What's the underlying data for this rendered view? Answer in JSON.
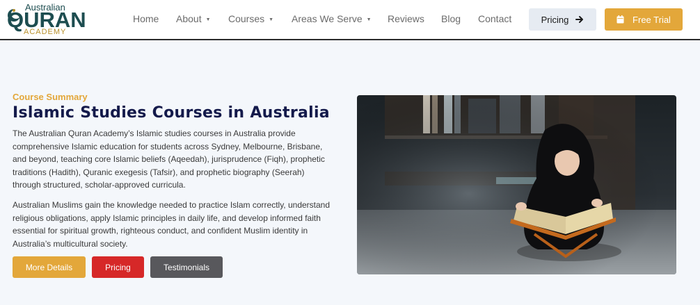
{
  "header": {
    "logo": {
      "top": "Australian",
      "main": "QURAN",
      "bottom": "ACADEMY"
    },
    "nav": [
      {
        "label": "Home",
        "dropdown": false
      },
      {
        "label": "About",
        "dropdown": true
      },
      {
        "label": "Courses",
        "dropdown": true
      },
      {
        "label": "Areas We Serve",
        "dropdown": true
      },
      {
        "label": "Reviews",
        "dropdown": false
      },
      {
        "label": "Blog",
        "dropdown": false
      },
      {
        "label": "Contact",
        "dropdown": false
      }
    ],
    "pricing_label": "Pricing",
    "trial_label": "Free Trial"
  },
  "main": {
    "eyebrow": "Course Summary",
    "title": "Islamic Studies Courses in Australia",
    "paragraph1": "The Australian Quran Academy’s Islamic studies courses in Australia provide comprehensive Islamic education for students across Sydney, Melbourne, Brisbane, and beyond, teaching core Islamic beliefs (Aqeedah), jurisprudence (Fiqh), prophetic traditions (Hadith), Quranic exegesis (Tafsir), and prophetic biography (Seerah) through structured, scholar-approved curricula.",
    "paragraph2": "Australian Muslims gain the knowledge needed to practice Islam correctly, understand religious obligations, apply Islamic principles in daily life, and develop informed faith essential for spiritual growth, righteous conduct, and confident Muslim identity in Australia’s multicultural society.",
    "buttons": {
      "more": "More Details",
      "pricing": "Pricing",
      "testimonials": "Testimonials"
    }
  },
  "colors": {
    "gold": "#e3a73a",
    "navy": "#141a4b",
    "red": "#d62828",
    "gray_button": "#58585c",
    "teal_logo": "#1d4d50",
    "page_bg": "#f4f7fb"
  },
  "icons": {
    "pricing_arrow": "arrow-right-icon",
    "trial": "calendar-icon",
    "nav_caret": "caret-down-icon"
  }
}
